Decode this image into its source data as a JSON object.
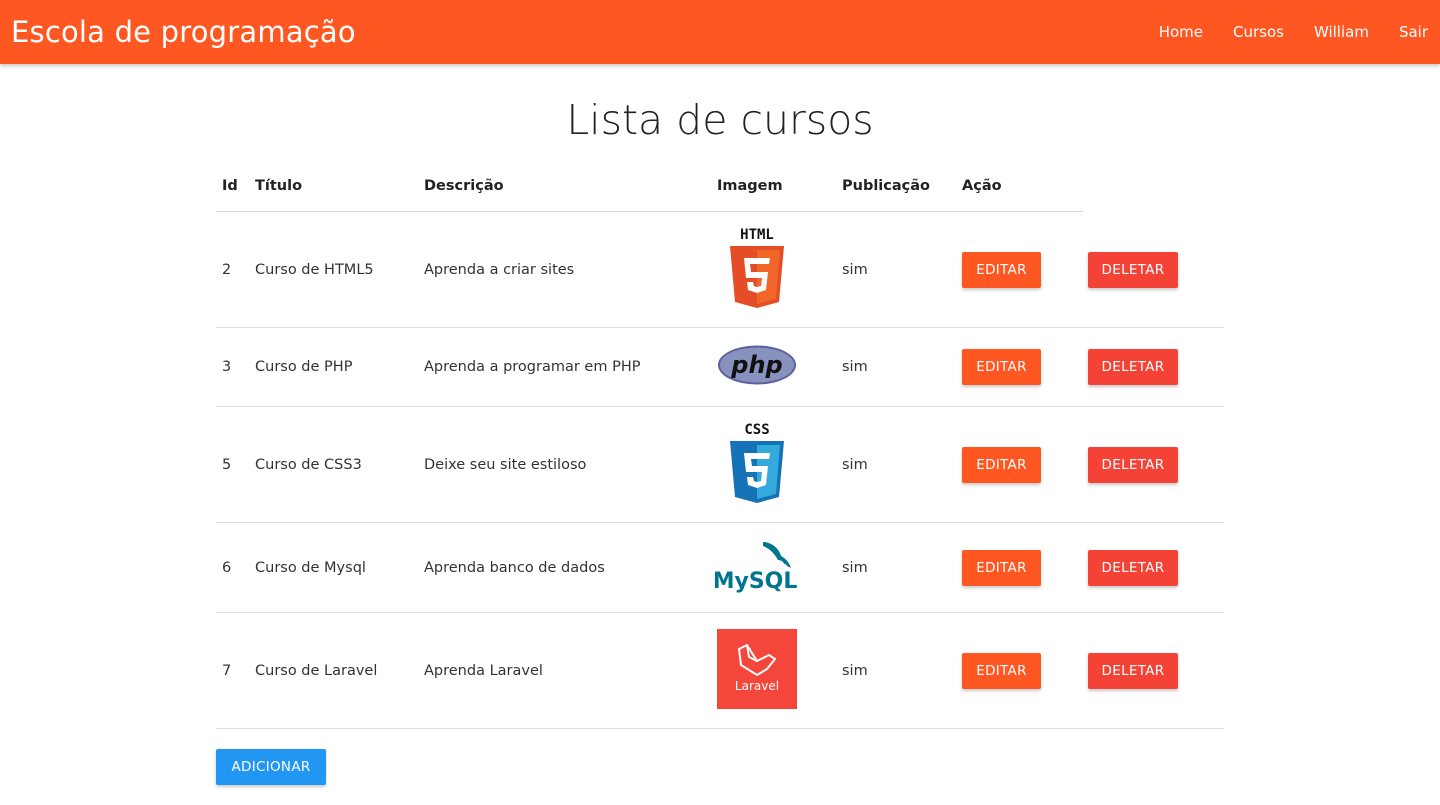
{
  "navbar": {
    "brand": "Escola de programação",
    "links": [
      "Home",
      "Cursos",
      "William",
      "Sair"
    ],
    "color": "#ff5722"
  },
  "page_title": "Lista de cursos",
  "table": {
    "headers": [
      "Id",
      "Título",
      "Descrição",
      "Imagem",
      "Publicação",
      "Ação"
    ],
    "rows": [
      {
        "id": "2",
        "titulo": "Curso de HTML5",
        "descricao": "Aprenda a criar sites",
        "imagem": "html5-logo",
        "publicacao": "sim",
        "edit_label": "EDITAR",
        "delete_label": "DELETAR"
      },
      {
        "id": "3",
        "titulo": "Curso de PHP",
        "descricao": "Aprenda a programar em PHP",
        "imagem": "php-logo",
        "publicacao": "sim",
        "edit_label": "EDITAR",
        "delete_label": "DELETAR"
      },
      {
        "id": "5",
        "titulo": "Curso de CSS3",
        "descricao": "Deixe seu site estiloso",
        "imagem": "css3-logo",
        "publicacao": "sim",
        "edit_label": "EDITAR",
        "delete_label": "DELETAR"
      },
      {
        "id": "6",
        "titulo": "Curso de Mysql",
        "descricao": "Aprenda banco de dados",
        "imagem": "mysql-logo",
        "publicacao": "sim",
        "edit_label": "EDITAR",
        "delete_label": "DELETAR"
      },
      {
        "id": "7",
        "titulo": "Curso de Laravel",
        "descricao": "Aprenda Laravel",
        "imagem": "laravel-logo",
        "publicacao": "sim",
        "edit_label": "EDITAR",
        "delete_label": "DELETAR"
      }
    ]
  },
  "add_button": "ADICIONAR",
  "logos": {
    "html5": "HTML",
    "php": "php",
    "css3": "CSS",
    "mysql": "MySQL",
    "laravel": "Laravel"
  },
  "colors": {
    "edit": "#ff5722",
    "delete": "#f44336",
    "add": "#2196f3"
  }
}
